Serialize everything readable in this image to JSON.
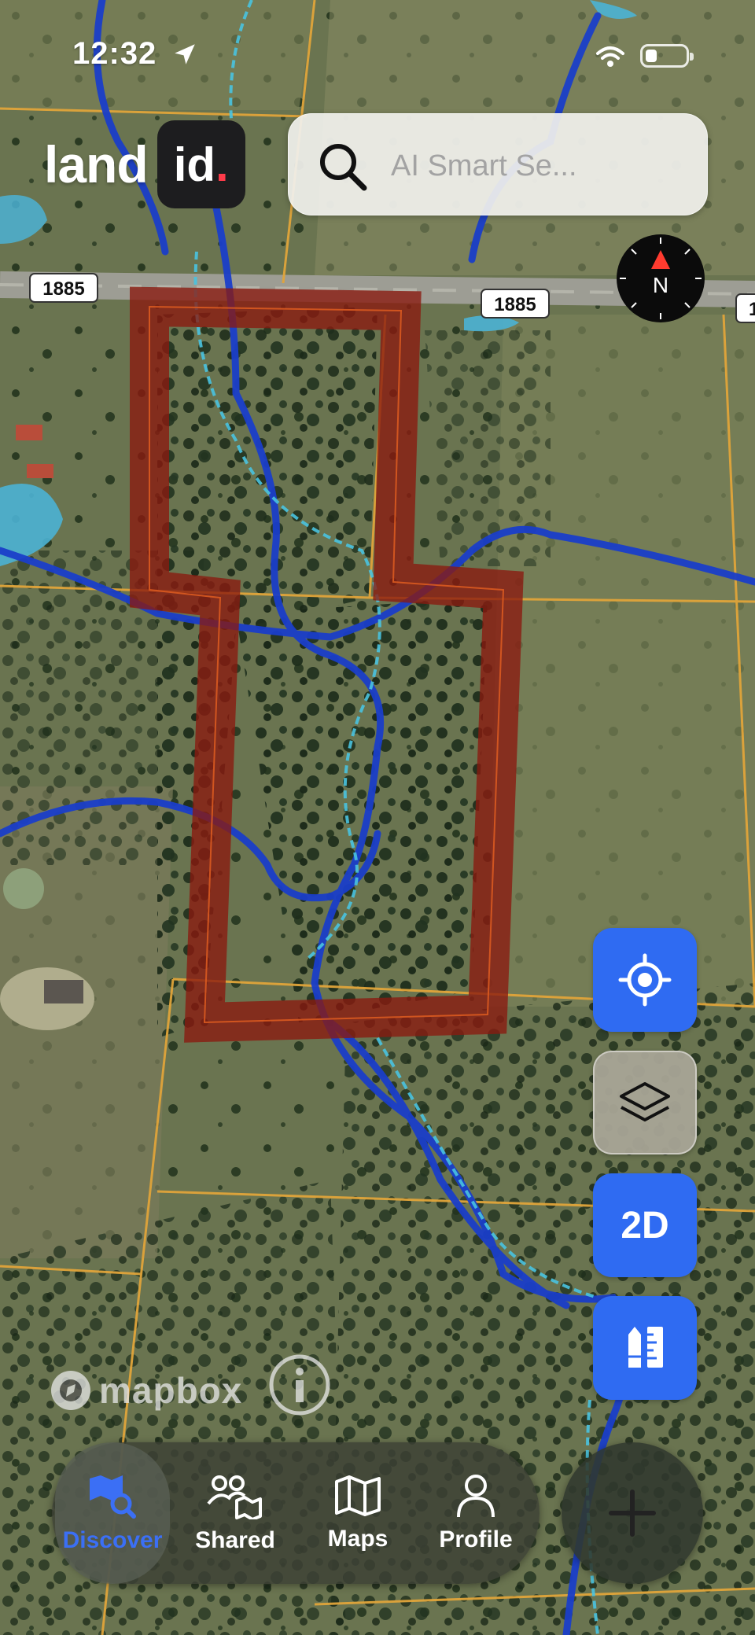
{
  "status_bar": {
    "time": "12:32"
  },
  "brand": {
    "word": "land",
    "badge": "id",
    "badge_dot": "."
  },
  "search": {
    "placeholder": "AI Smart Se..."
  },
  "map": {
    "road_labels": [
      "1885",
      "1885",
      "1"
    ],
    "attribution": "mapbox",
    "parcel_color": "#8b1a10"
  },
  "controls": {
    "locate_icon": "crosshair-icon",
    "layers_icon": "layers-icon",
    "view_mode_label": "2D",
    "measure_icon": "pencil-ruler-icon"
  },
  "nav": {
    "items": [
      {
        "label": "Discover",
        "icon": "map-search-icon",
        "active": true
      },
      {
        "label": "Shared",
        "icon": "people-map-icon",
        "active": false
      },
      {
        "label": "Maps",
        "icon": "folded-map-icon",
        "active": false
      },
      {
        "label": "Profile",
        "icon": "person-icon",
        "active": false
      }
    ]
  },
  "colors": {
    "accent": "#2f6bf2",
    "brand_dot": "#ff3b4a",
    "active_tab": "#3b6ff5"
  }
}
